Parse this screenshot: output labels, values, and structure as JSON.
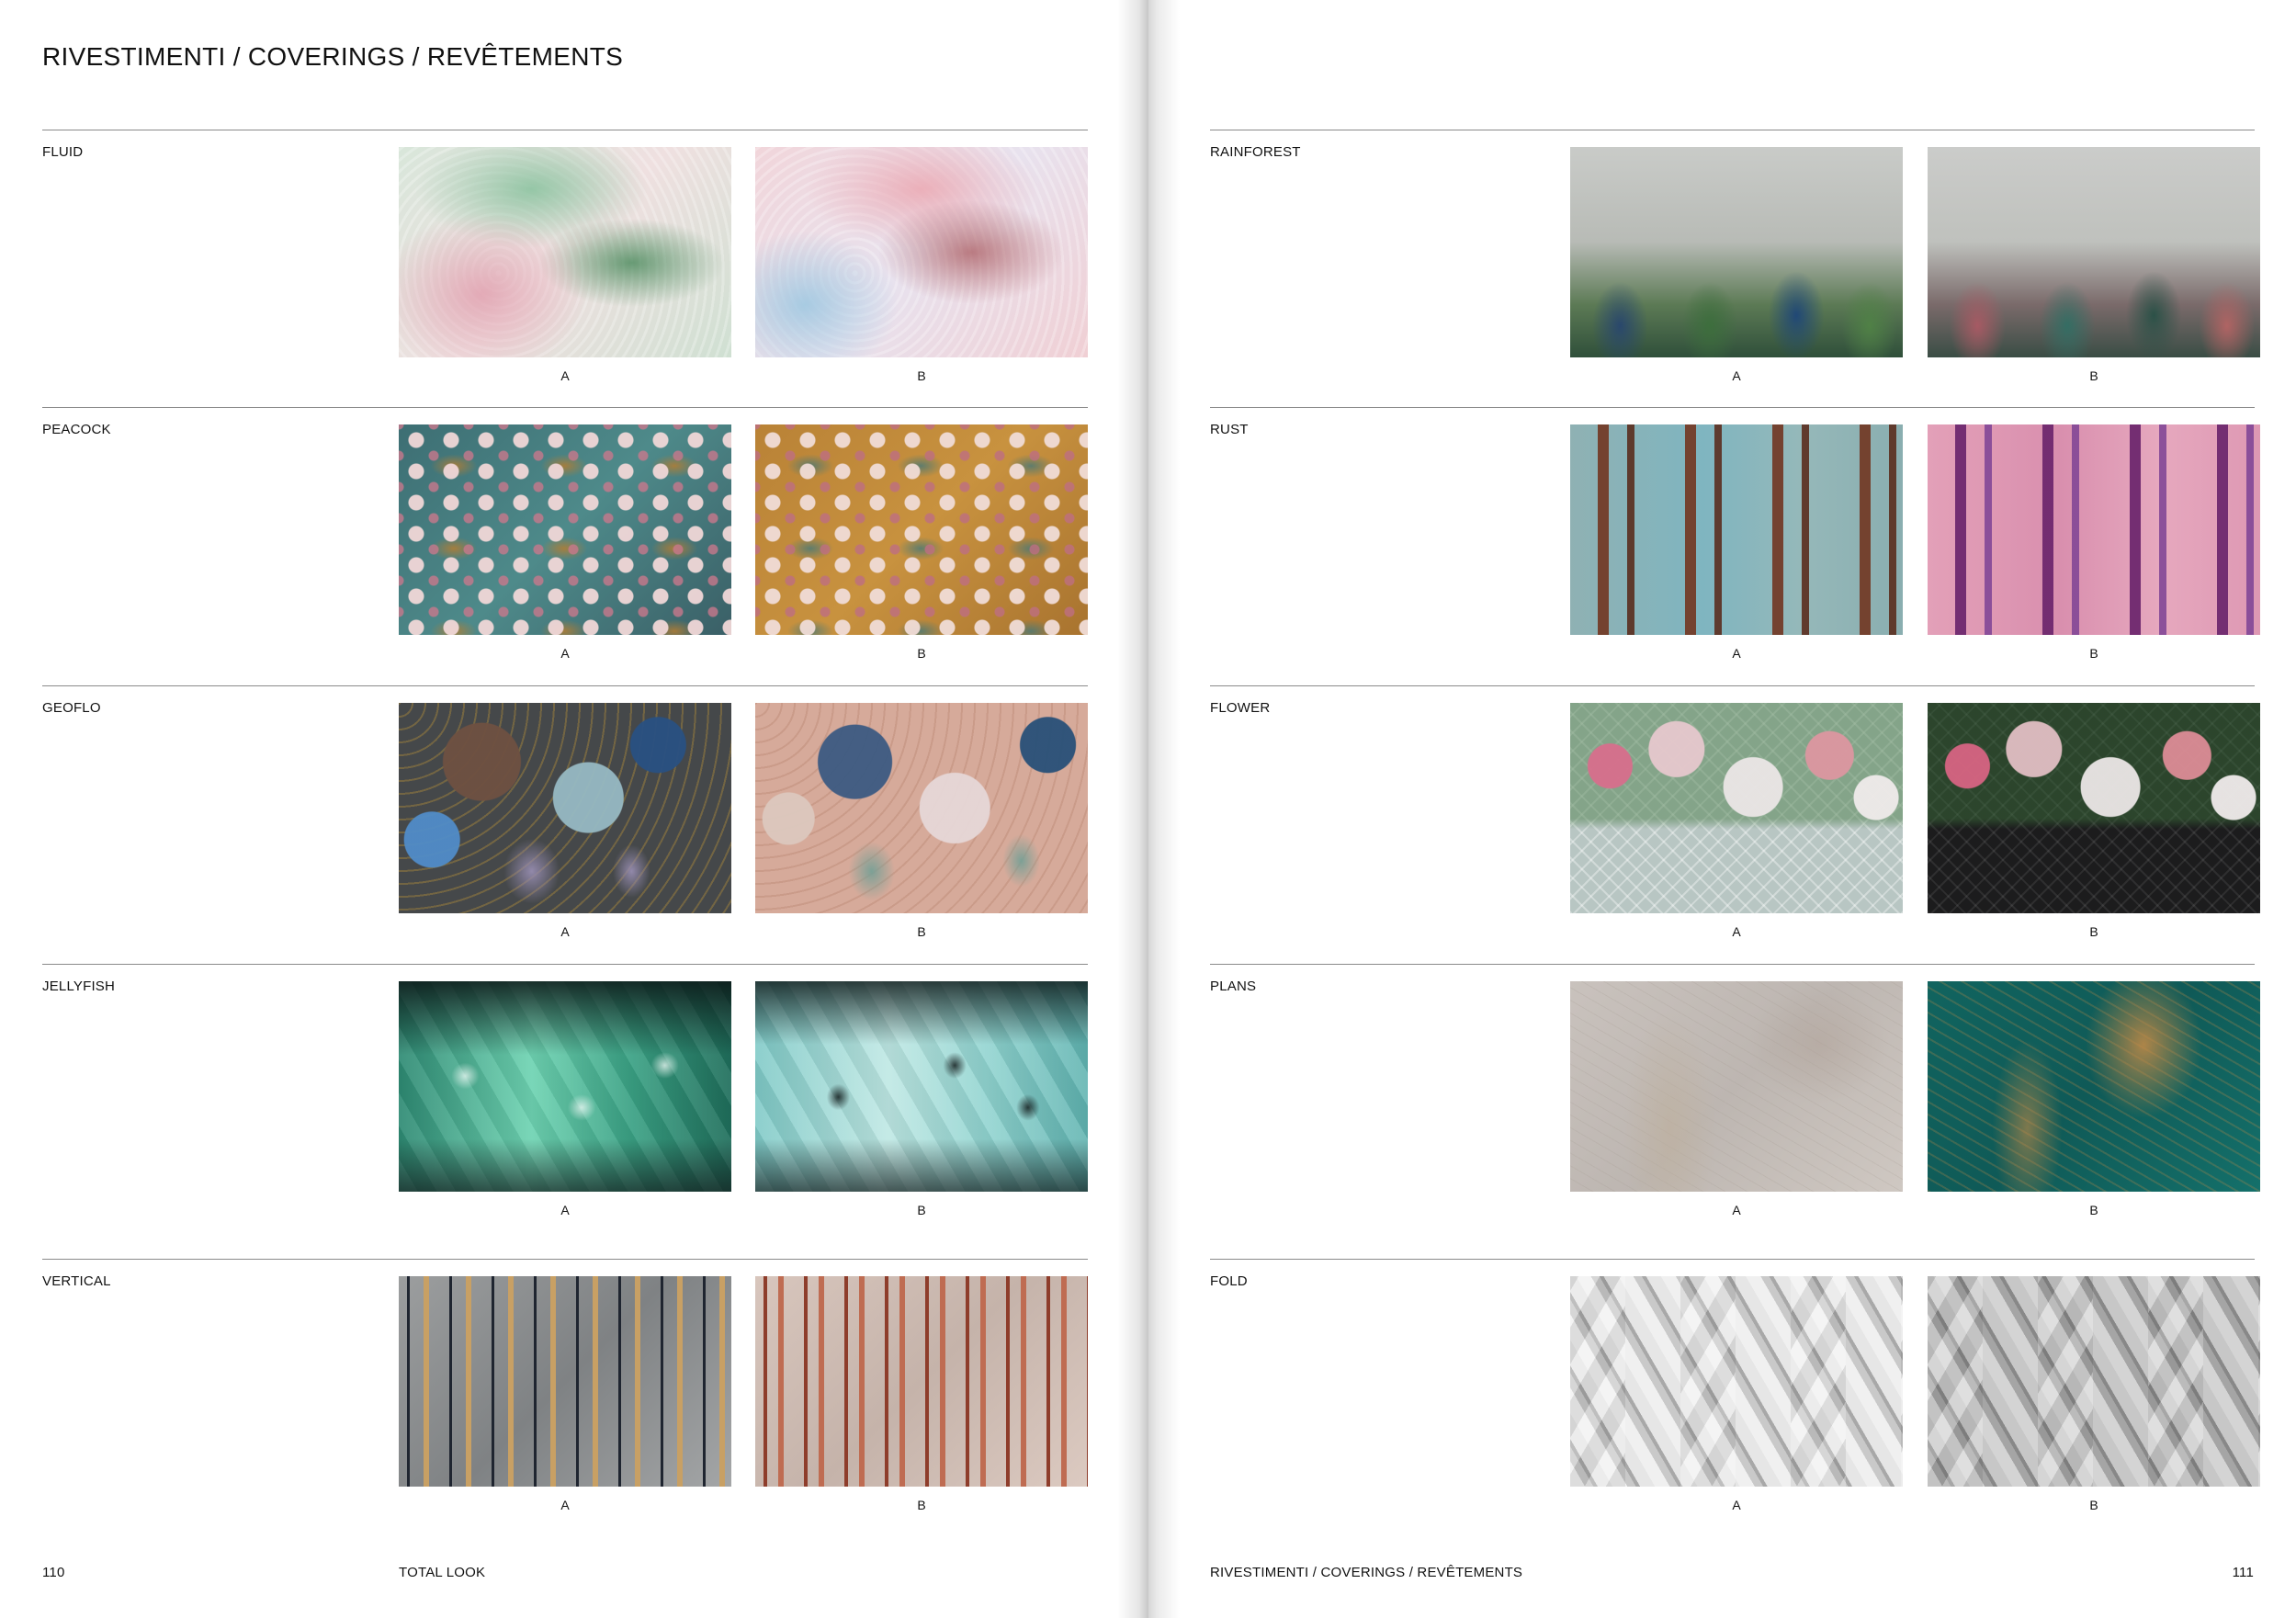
{
  "left_page": {
    "title": "RIVESTIMENTI / COVERINGS / REVÊTEMENTS",
    "rows": [
      {
        "name": "FLUID",
        "a": "A",
        "b": "B"
      },
      {
        "name": "PEACOCK",
        "a": "A",
        "b": "B"
      },
      {
        "name": "GEOFLO",
        "a": "A",
        "b": "B"
      },
      {
        "name": "JELLYFISH",
        "a": "A",
        "b": "B"
      },
      {
        "name": "VERTICAL",
        "a": "A",
        "b": "B"
      }
    ],
    "page_number": "110",
    "footer_label": "TOTAL LOOK"
  },
  "right_page": {
    "rows": [
      {
        "name": "RAINFOREST",
        "a": "A",
        "b": "B"
      },
      {
        "name": "RUST",
        "a": "A",
        "b": "B"
      },
      {
        "name": "FLOWER",
        "a": "A",
        "b": "B"
      },
      {
        "name": "PLANS",
        "a": "A",
        "b": "B"
      },
      {
        "name": "FOLD",
        "a": "A",
        "b": "B"
      }
    ],
    "footer_label": "RIVESTIMENTI / COVERINGS / REVÊTEMENTS",
    "page_number": "111"
  }
}
